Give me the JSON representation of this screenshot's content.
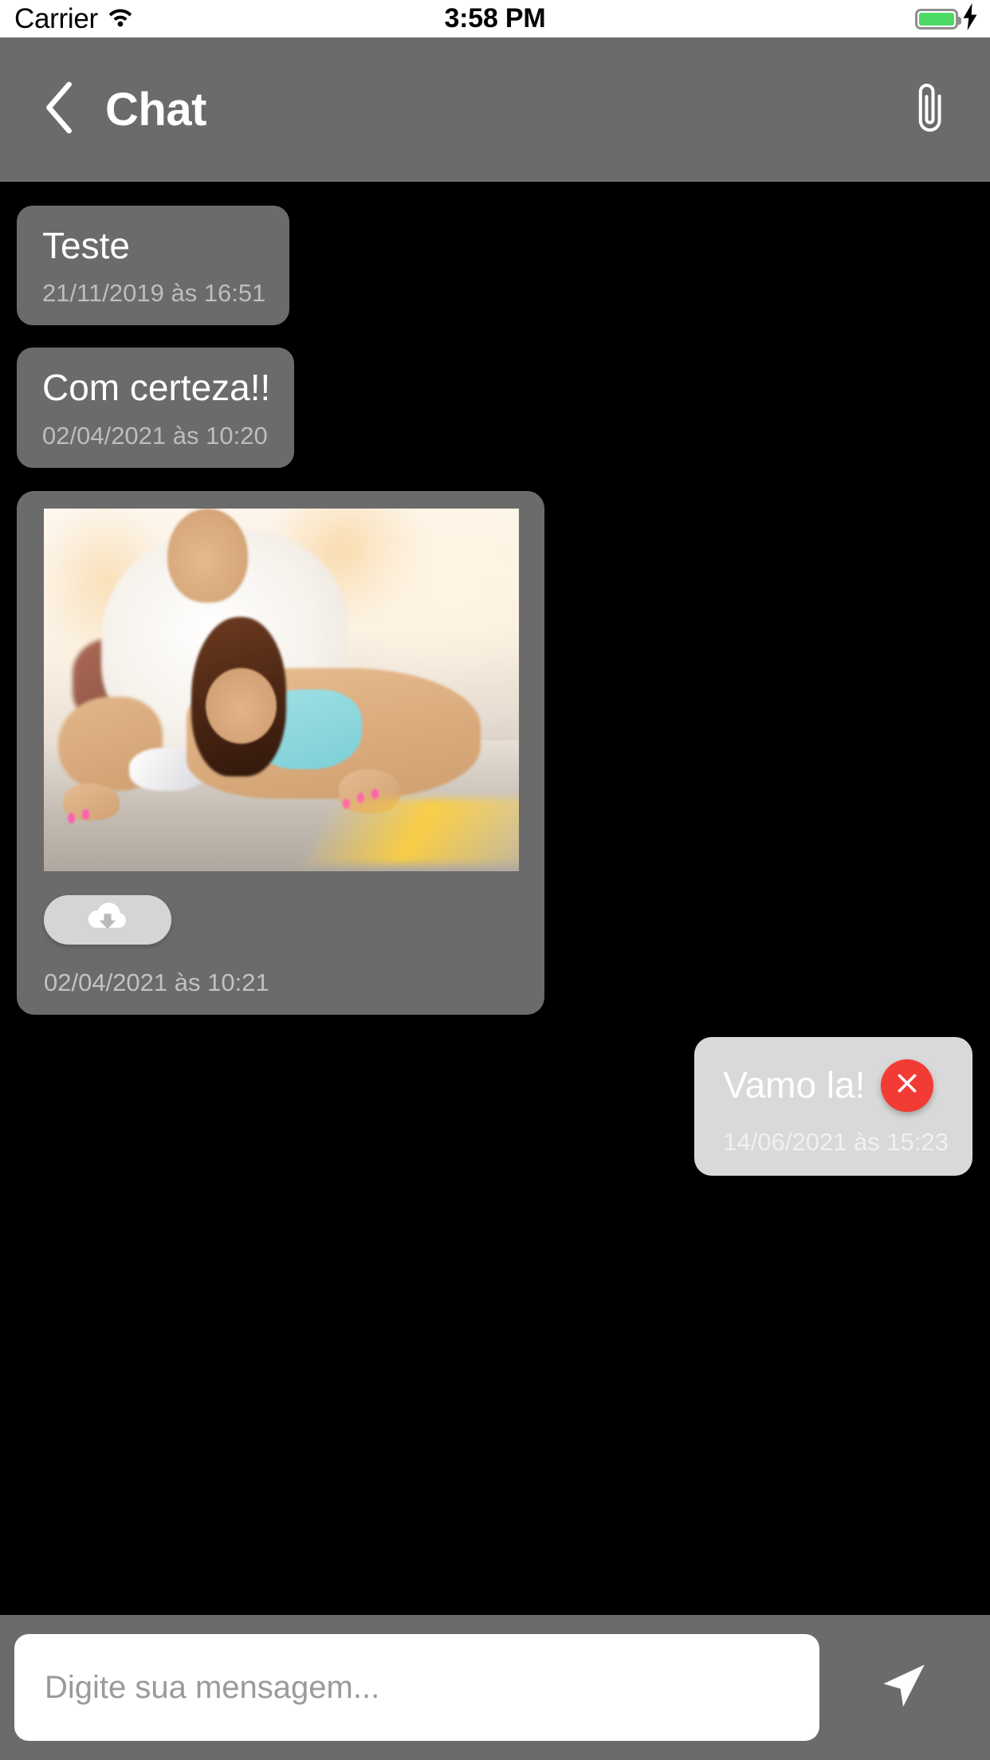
{
  "status_bar": {
    "carrier": "Carrier",
    "time": "3:58 PM",
    "wifi_icon": "wifi-icon",
    "battery_icon": "battery-icon",
    "charging_icon": "lightning-bolt-icon",
    "battery_color": "#4cd964"
  },
  "nav_bar": {
    "back_icon": "chevron-left-icon",
    "title": "Chat",
    "attach_icon": "paperclip-icon",
    "background_color": "#6b6b6b"
  },
  "messages": [
    {
      "id": "msg-1",
      "side": "incoming",
      "type": "text",
      "text": "Teste",
      "time": "21/11/2019 às 16:51"
    },
    {
      "id": "msg-2",
      "side": "incoming",
      "type": "text",
      "text": "Com certeza!!",
      "time": "02/04/2021 às 10:20"
    },
    {
      "id": "msg-3",
      "side": "incoming",
      "type": "image",
      "image_alt": "Foto de treino na academia - flexao de braco",
      "download_icon": "cloud-download-icon",
      "time": "02/04/2021 às 10:21"
    },
    {
      "id": "msg-4",
      "side": "outgoing",
      "type": "text",
      "text": "Vamo la!",
      "time": "14/06/2021 às 15:23",
      "close_icon": "close-x-icon",
      "close_button_color": "#f23b34"
    }
  ],
  "composer": {
    "placeholder": "Digite sua mensagem...",
    "value": "",
    "send_icon": "send-paper-plane-icon",
    "background_color": "#6b6b6b"
  }
}
